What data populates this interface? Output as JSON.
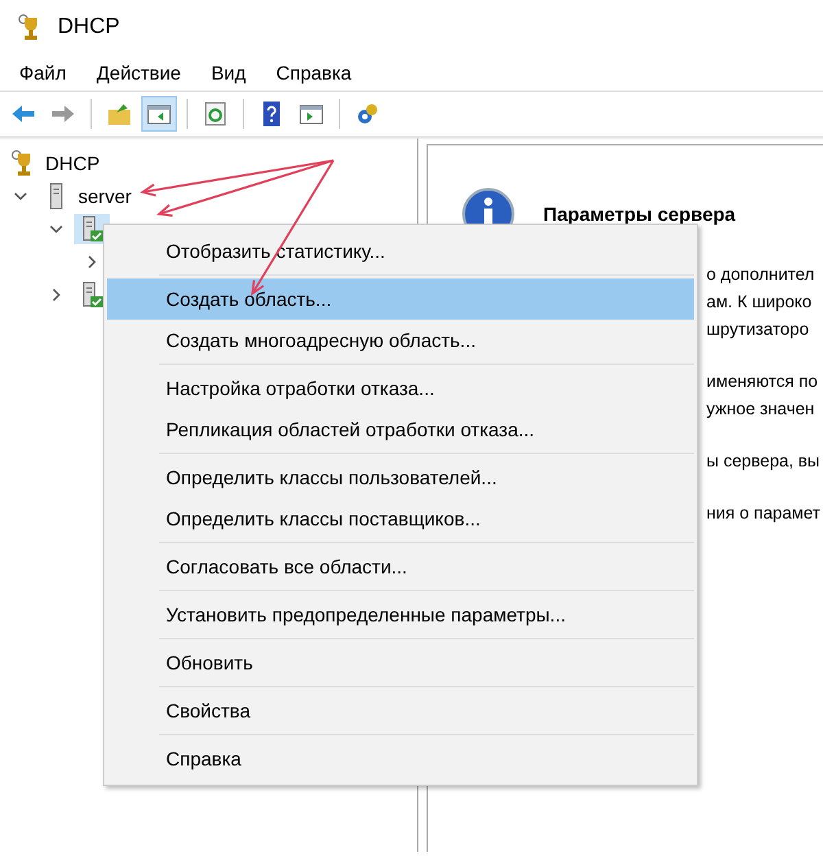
{
  "window": {
    "title": "DHCP"
  },
  "menu_bar": [
    {
      "label": "Файл"
    },
    {
      "label": "Действие"
    },
    {
      "label": "Вид"
    },
    {
      "label": "Справка"
    }
  ],
  "toolbar": [
    {
      "kind": "back",
      "disabled": false,
      "pressed": false
    },
    {
      "kind": "forward",
      "disabled": true,
      "pressed": false
    },
    {
      "kind": "sep"
    },
    {
      "kind": "up",
      "pressed": false
    },
    {
      "kind": "tree",
      "pressed": true
    },
    {
      "kind": "sep"
    },
    {
      "kind": "refresh",
      "pressed": false
    },
    {
      "kind": "sep"
    },
    {
      "kind": "help",
      "pressed": false
    },
    {
      "kind": "pane",
      "pressed": false
    },
    {
      "kind": "sep"
    },
    {
      "kind": "gears",
      "pressed": false
    }
  ],
  "tree": [
    {
      "kind": "root",
      "label": "DHCP",
      "selected": false,
      "children": [
        {
          "kind": "server",
          "label": "server",
          "expanded": true,
          "selected": false,
          "children": [
            {
              "kind": "protocol",
              "expanded": true,
              "selected": true,
              "children": [
                {
                  "expanded": false
                }
              ]
            },
            {
              "kind": "protocol",
              "expanded": false,
              "selected": false
            }
          ]
        }
      ]
    }
  ],
  "details": {
    "heading": "Параметры сервера",
    "paragraphs": [
      [
        "о дополнител",
        "ам. К широко",
        "шрутизаторо"
      ],
      [
        "именяются по",
        "ужное значен"
      ],
      [
        "ы сервера, вы"
      ],
      [
        "ния о парамет"
      ]
    ]
  },
  "context_menu": {
    "groups": [
      [
        {
          "label": "Отобразить статистику...",
          "selected": false
        }
      ],
      [
        {
          "label": "Создать область...",
          "selected": true
        },
        {
          "label": "Создать многоадресную область...",
          "selected": false
        }
      ],
      [
        {
          "label": "Настройка отработки отказа...",
          "selected": false
        },
        {
          "label": "Репликация областей отработки отказа...",
          "selected": false
        }
      ],
      [
        {
          "label": "Определить классы пользователей...",
          "selected": false
        },
        {
          "label": "Определить классы поставщиков...",
          "selected": false
        }
      ],
      [
        {
          "label": "Согласовать все области...",
          "selected": false
        }
      ],
      [
        {
          "label": "Установить предопределенные параметры...",
          "selected": false
        }
      ],
      [
        {
          "label": "Обновить",
          "selected": false
        }
      ],
      [
        {
          "label": "Свойства",
          "selected": false
        }
      ],
      [
        {
          "label": "Справка",
          "selected": false
        }
      ]
    ]
  }
}
